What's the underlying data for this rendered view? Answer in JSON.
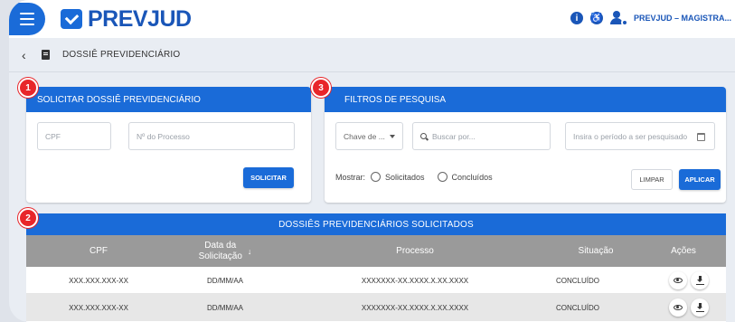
{
  "app": {
    "logo_text": "PREVJUD",
    "user_name": "PREVJUD – MAGISTRA..."
  },
  "breadcrumb": {
    "back_icon": "chevron-left-icon",
    "title": "DOSSIÊ PREVIDENCIÁRIO"
  },
  "steps": {
    "one": "1",
    "two": "2",
    "three": "3"
  },
  "request_panel": {
    "title": "SOLICITAR DOSSIÊ PREVIDENCIÁRIO",
    "cpf_placeholder": "CPF",
    "process_placeholder": "Nº do Processo",
    "submit_label": "SOLICITAR"
  },
  "filter_panel": {
    "title": "FILTROS DE PESQUISA",
    "key_select": "Chave de ...",
    "search_placeholder": "Buscar por...",
    "period_placeholder": "Insira o período a ser pesquisado",
    "show_label": "Mostrar:",
    "radio_requested": "Solicitados",
    "radio_completed": "Concluídos",
    "clear_label": "LIMPAR",
    "apply_label": "APLICAR"
  },
  "table": {
    "title": "DOSSIÊS PREVIDENCIÁRIOS SOLICITADOS",
    "columns": {
      "cpf": "CPF",
      "date_line1": "Data da",
      "date_line2": "Solicitação",
      "process": "Processo",
      "status": "Situação",
      "actions": "Ações"
    },
    "sort_indicator": "↓",
    "rows": [
      {
        "cpf": "XXX.XXX.XXX-XX",
        "date": "DD/MM/AA",
        "process": "XXXXXXX-XX.XXXX.X.XX.XXXX",
        "status": "CONCLUÍDO"
      },
      {
        "cpf": "XXX.XXX.XXX-XX",
        "date": "DD/MM/AA",
        "process": "XXXXXXX-XX.XXXX.X.XX.XXXX",
        "status": "CONCLUÍDO"
      }
    ]
  },
  "colors": {
    "primary": "#1a6bd8",
    "step_badge": "#e8262a",
    "table_header": "#9a9a9a"
  }
}
